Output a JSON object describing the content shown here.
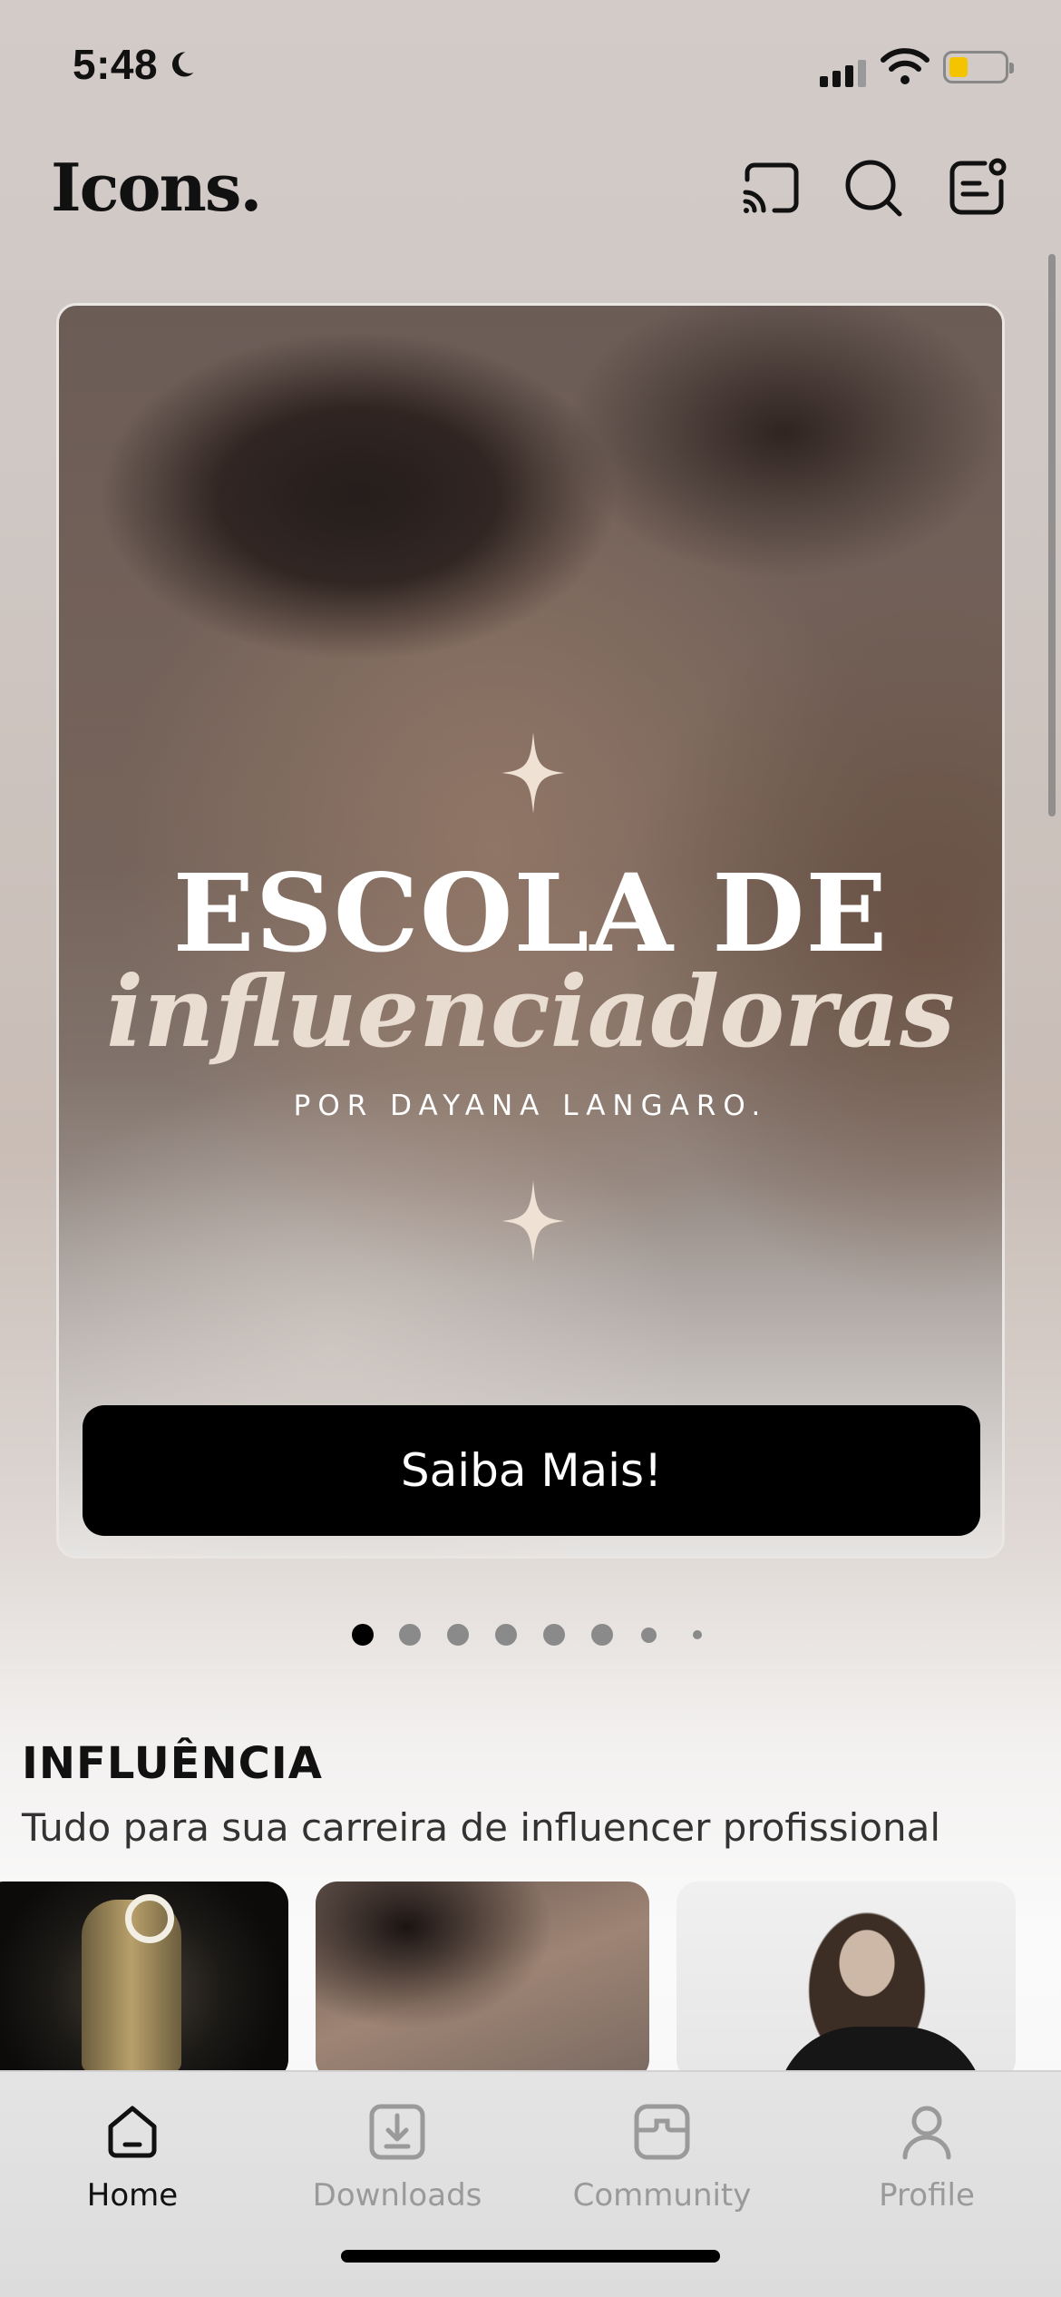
{
  "status_bar": {
    "time": "5:48",
    "icons": [
      "moon-icon",
      "cellular-signal-icon",
      "wifi-icon",
      "battery-icon"
    ]
  },
  "header": {
    "logo": "Icons.",
    "actions": [
      "cast-icon",
      "search-icon",
      "chat-icon"
    ]
  },
  "hero": {
    "title": "ESCOLA DE",
    "script_title": "influenciadoras",
    "byline": "POR DAYANA LANGARO.",
    "cta_label": "Saiba Mais!"
  },
  "carousel": {
    "total_dots": 8,
    "active_index": 0
  },
  "section": {
    "title": "INFLUÊNCIA",
    "subtitle": "Tudo para sua carreira de influencer profissional"
  },
  "tabs": [
    {
      "label": "Home",
      "icon": "home-icon",
      "active": true
    },
    {
      "label": "Downloads",
      "icon": "download-icon",
      "active": false
    },
    {
      "label": "Community",
      "icon": "community-icon",
      "active": false
    },
    {
      "label": "Profile",
      "icon": "profile-icon",
      "active": false
    }
  ],
  "colors": {
    "accent": "#000000",
    "script_color": "#e9ddd2",
    "battery": "#f5c400",
    "inactive_tab": "#9a9a9a"
  }
}
